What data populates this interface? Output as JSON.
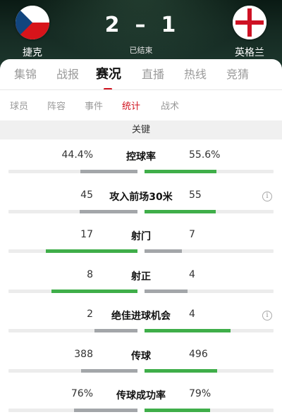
{
  "match": {
    "home_team": "捷克",
    "away_team": "英格兰",
    "home_score": "2",
    "away_score": "1",
    "separator": "–",
    "status": "已结束"
  },
  "main_tabs": [
    "集锦",
    "战报",
    "赛况",
    "直播",
    "热线",
    "竞猜"
  ],
  "main_tab_active": "赛况",
  "sub_tabs": [
    "球员",
    "阵容",
    "事件",
    "统计",
    "战术"
  ],
  "sub_tab_active": "统计",
  "section_title": "关键",
  "colors": {
    "leading_bar": "#3fae49",
    "trailing_bar": "#a3a6a9",
    "accent": "#d0131f"
  },
  "stats": [
    {
      "label": "控球率",
      "home": "44.4%",
      "away": "55.6%",
      "home_ratio": 0.444,
      "away_ratio": 0.556,
      "info": false
    },
    {
      "label": "攻入前场30米",
      "home": "45",
      "away": "55",
      "home_ratio": 0.45,
      "away_ratio": 0.55,
      "info": true
    },
    {
      "label": "射门",
      "home": "17",
      "away": "7",
      "home_ratio": 0.708,
      "away_ratio": 0.292,
      "info": false
    },
    {
      "label": "射正",
      "home": "8",
      "away": "4",
      "home_ratio": 0.667,
      "away_ratio": 0.333,
      "info": false
    },
    {
      "label": "绝佳进球机会",
      "home": "2",
      "away": "4",
      "home_ratio": 0.333,
      "away_ratio": 0.667,
      "info": true
    },
    {
      "label": "传球",
      "home": "388",
      "away": "496",
      "home_ratio": 0.439,
      "away_ratio": 0.561,
      "info": false
    },
    {
      "label": "传球成功率",
      "home": "76%",
      "away": "79%",
      "home_ratio": 0.49,
      "away_ratio": 0.51,
      "info": false
    }
  ],
  "info_icon_glyph": "i"
}
